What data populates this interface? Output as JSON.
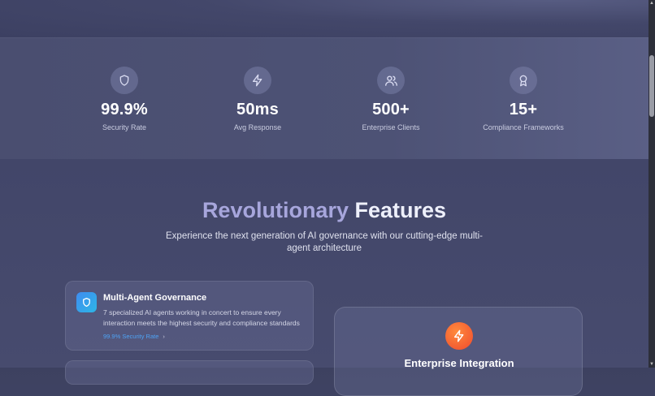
{
  "stats": [
    {
      "icon": "shield-icon",
      "value": "99.9%",
      "label": "Security Rate"
    },
    {
      "icon": "lightning-icon",
      "value": "50ms",
      "label": "Avg Response"
    },
    {
      "icon": "users-icon",
      "value": "500+",
      "label": "Enterprise Clients"
    },
    {
      "icon": "award-icon",
      "value": "15+",
      "label": "Compliance Frameworks"
    }
  ],
  "features": {
    "heading_accent": "Revolutionary",
    "heading_rest": "Features",
    "subtitle": "Experience the next generation of AI governance with our cutting-edge multi-agent architecture"
  },
  "cards": [
    {
      "icon": "shield-icon",
      "title": "Multi-Agent Governance",
      "description": "7 specialized AI agents working in concert to ensure every interaction meets the highest security and compliance standards",
      "link": "99.9% Security Rate"
    }
  ],
  "enterprise": {
    "icon": "zap-icon",
    "title": "Enterprise Integration"
  },
  "colors": {
    "accent": "#a7a6dc",
    "link": "#4ea3f5",
    "card_icon": "#3f8cf0",
    "enterprise_icon": "#ef4a2e"
  }
}
